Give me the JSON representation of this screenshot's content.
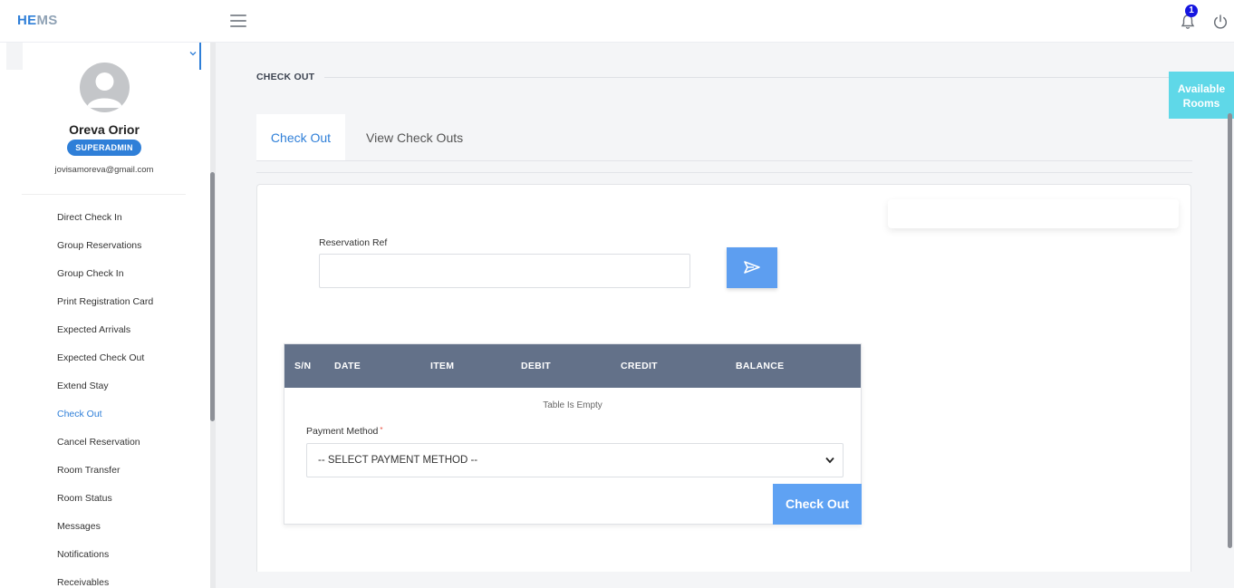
{
  "app": {
    "logo_part1": "HE",
    "logo_part2": "MS",
    "notification_count": "1"
  },
  "user": {
    "name": "Oreva Orior",
    "role": "SUPERADMIN",
    "email": "jovisamoreva@gmail.com"
  },
  "sidebar": {
    "items": [
      {
        "label": "Direct Check In"
      },
      {
        "label": "Group Reservations"
      },
      {
        "label": "Group Check In"
      },
      {
        "label": "Print Registration Card"
      },
      {
        "label": "Expected Arrivals"
      },
      {
        "label": "Expected Check Out"
      },
      {
        "label": "Extend Stay"
      },
      {
        "label": "Check Out"
      },
      {
        "label": "Cancel Reservation"
      },
      {
        "label": "Room Transfer"
      },
      {
        "label": "Room Status"
      },
      {
        "label": "Messages"
      },
      {
        "label": "Notifications"
      },
      {
        "label": "Receivables"
      }
    ],
    "active_item": "Check Out"
  },
  "page": {
    "heading": "CHECK OUT",
    "available_rooms_line1": "Available",
    "available_rooms_line2": "Rooms",
    "tabs": [
      {
        "label": "Check Out"
      },
      {
        "label": "View Check Outs"
      }
    ]
  },
  "form": {
    "reservation_ref_label": "Reservation Ref",
    "reservation_ref_value": ""
  },
  "table": {
    "columns": [
      "S/N",
      "DATE",
      "ITEM",
      "DEBIT",
      "CREDIT",
      "BALANCE"
    ],
    "rows": [],
    "empty_message": "Table Is Empty"
  },
  "payment": {
    "label": "Payment Method",
    "required_mark": "*",
    "selected": "-- SELECT PAYMENT METHOD --",
    "submit_label": "Check Out"
  },
  "colors": {
    "accent": "#2f7fd8",
    "table_header": "#637189",
    "available_rooms_bg": "#5fd8e8",
    "button_blue": "#5fa2f3",
    "badge_bg": "#1515e0"
  }
}
